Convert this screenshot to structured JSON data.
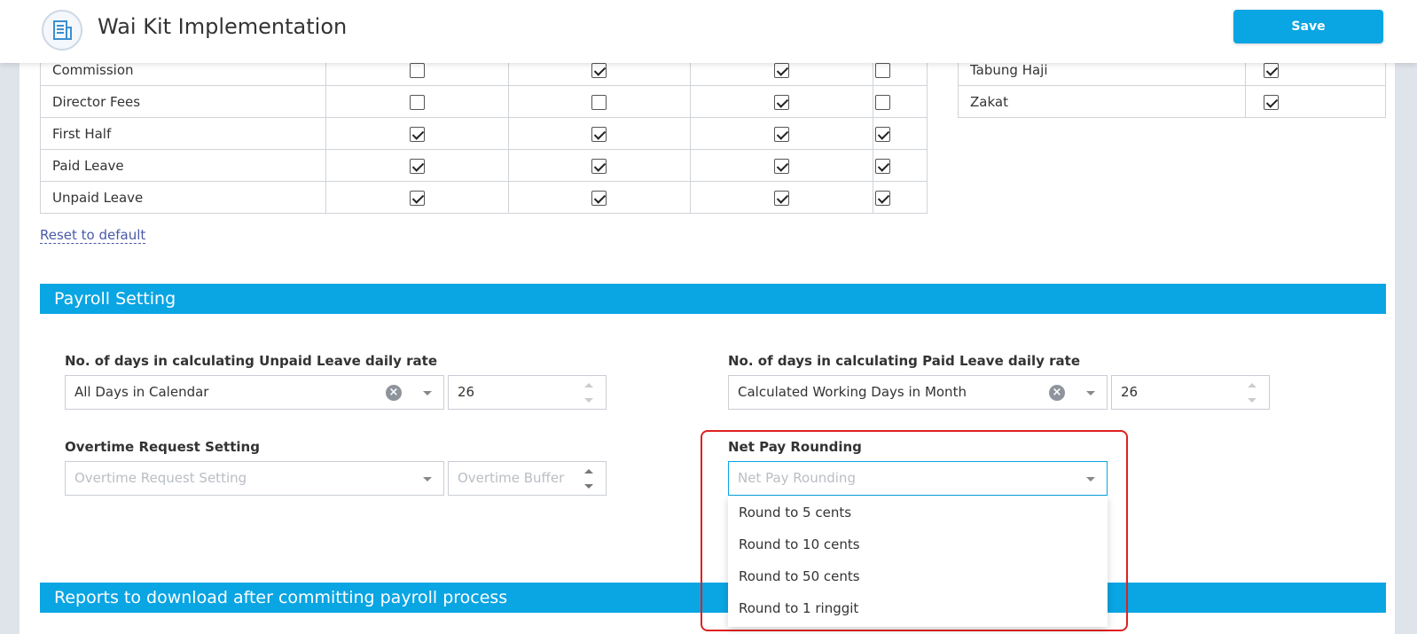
{
  "header": {
    "title": "Wai Kit Implementation",
    "save_label": "Save"
  },
  "left_table": {
    "rows": [
      {
        "label": "Commission",
        "checks": [
          false,
          true,
          true,
          false
        ]
      },
      {
        "label": "Director Fees",
        "checks": [
          false,
          false,
          true,
          false
        ]
      },
      {
        "label": "First Half",
        "checks": [
          true,
          true,
          true,
          true
        ]
      },
      {
        "label": "Paid Leave",
        "checks": [
          true,
          true,
          true,
          true
        ]
      },
      {
        "label": "Unpaid Leave",
        "checks": [
          true,
          true,
          true,
          true
        ]
      }
    ]
  },
  "right_table": {
    "rows": [
      {
        "label": "Tabung Haji",
        "checked": true
      },
      {
        "label": "Zakat",
        "checked": true
      }
    ]
  },
  "reset_link": "Reset to default",
  "payroll_section": {
    "title": "Payroll Setting",
    "unpaid_leave": {
      "label": "No. of days in calculating Unpaid Leave daily rate",
      "selected": "All Days in Calendar",
      "days": "26"
    },
    "paid_leave": {
      "label": "No. of days in calculating Paid Leave daily rate",
      "selected": "Calculated Working Days in Month",
      "days": "26"
    },
    "overtime": {
      "label": "Overtime Request Setting",
      "placeholder": "Overtime Request Setting",
      "buffer_placeholder": "Overtime Buffer"
    },
    "net_pay_rounding": {
      "label": "Net Pay Rounding",
      "placeholder": "Net Pay Rounding",
      "options": [
        "Round to 5 cents",
        "Round to 10 cents",
        "Round to 50 cents",
        "Round to 1 ringgit"
      ]
    }
  },
  "reports_section": {
    "title": "Reports to download after committing payroll process"
  },
  "colors": {
    "accent": "#0aa5e3",
    "highlight": "#e02020"
  }
}
